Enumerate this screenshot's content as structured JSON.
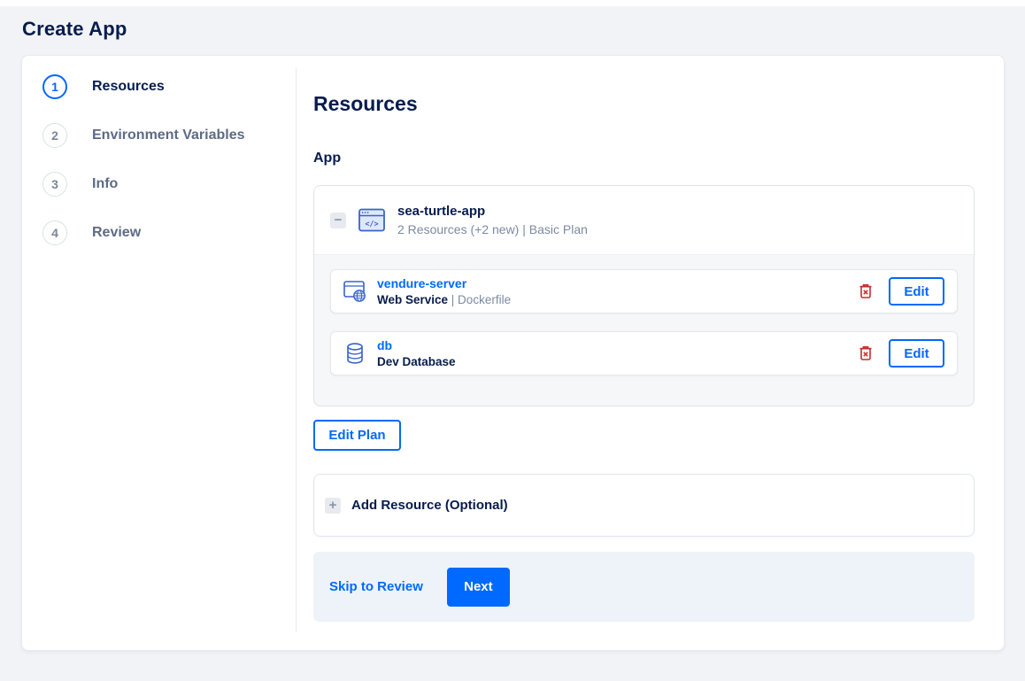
{
  "page_title": "Create App",
  "colors": {
    "accent_blue": "#0069ff",
    "navy_text": "#071c4d",
    "muted_gray_text": "#7c8aa0",
    "step_inactive_text": "#5d6b84",
    "danger_red": "#c32f2a",
    "page_background": "#f1f3f6",
    "footer_background": "#eef3f9",
    "icon_blue": "#3a62c9"
  },
  "wizard": {
    "steps": [
      {
        "number": "1",
        "label": "Resources"
      },
      {
        "number": "2",
        "label": "Environment Variables"
      },
      {
        "number": "3",
        "label": "Info"
      },
      {
        "number": "4",
        "label": "Review"
      }
    ]
  },
  "main": {
    "heading": "Resources",
    "section_label": "App",
    "app_card": {
      "collapse_glyph": "−",
      "name": "sea-turtle-app",
      "summary": "2 Resources (+2 new) | Basic Plan",
      "resources": [
        {
          "name": "vendure-server",
          "type": "Web Service",
          "type_suffix": " | Dockerfile",
          "edit_label": "Edit"
        },
        {
          "name": "db",
          "type": "Dev Database",
          "type_suffix": "",
          "edit_label": "Edit"
        }
      ]
    },
    "edit_plan_label": "Edit Plan",
    "add_glyph": "+",
    "add_resource_label": "Add Resource (Optional)",
    "footer": {
      "skip_label": "Skip to Review",
      "next_label": "Next"
    }
  }
}
